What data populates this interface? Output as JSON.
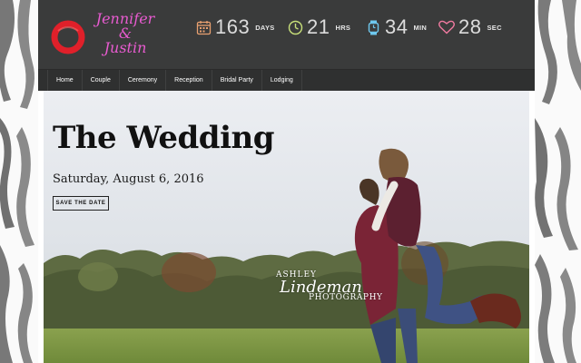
{
  "brand": {
    "name_line1": "Jennifer",
    "name_line2": "&",
    "name_line3": "Justin"
  },
  "countdown": [
    {
      "value": "163",
      "unit": "DAYS",
      "icon": "calendar-icon",
      "color": "#e8a070"
    },
    {
      "value": "21",
      "unit": "HRS",
      "icon": "clock-icon",
      "color": "#c8e07a"
    },
    {
      "value": "34",
      "unit": "MIN",
      "icon": "watch-icon",
      "color": "#6ec8ee"
    },
    {
      "value": "28",
      "unit": "SEC",
      "icon": "heart-icon",
      "color": "#f07aa0"
    }
  ],
  "nav": {
    "items": [
      "Home",
      "Couple",
      "Ceremony",
      "Reception",
      "Bridal Party",
      "Lodging"
    ]
  },
  "hero": {
    "title": "The Wedding",
    "date": "Saturday, August 6, 2016",
    "button": "SAVE THE DATE"
  },
  "watermark": {
    "line1": "ASHLEY",
    "line2": "Lindeman",
    "line3": "PHOTOGRAPHY"
  },
  "colors": {
    "header_bg": "#3a3b3b",
    "nav_bg": "#2f3030",
    "brand_pink": "#e85bd0",
    "logo_red": "#e0202a"
  }
}
